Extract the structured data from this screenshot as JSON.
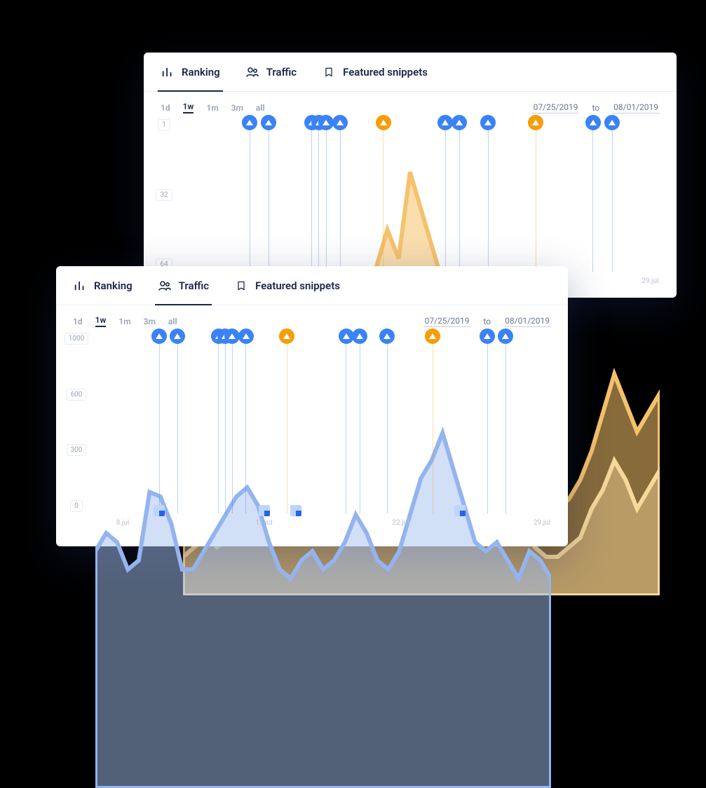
{
  "tabs": {
    "ranking": "Ranking",
    "traffic": "Traffic",
    "featured": "Featured snippets"
  },
  "ranges": {
    "d": "1d",
    "w": "1w",
    "m": "1m",
    "m3": "3m",
    "all": "all"
  },
  "dates": {
    "from": "07/25/2019",
    "sep": "to",
    "to": "08/01/2019"
  },
  "chart_data": [
    {
      "title": "Ranking",
      "type": "area",
      "y_inverted": true,
      "ylabels": [
        "1",
        "32",
        "64"
      ],
      "xlabels": [
        "8.jul",
        "15.jul",
        "22.jul",
        "29.jul"
      ],
      "x_positions_pct": [
        6,
        37,
        67,
        98
      ],
      "series": [
        {
          "name": "rank_a",
          "color": "#f5c26b",
          "fill": "rgba(245,194,107,0.55)",
          "points": [
            68,
            78,
            80,
            80,
            80,
            72,
            64,
            68,
            74,
            68,
            62,
            70,
            58,
            48,
            44,
            52,
            40,
            32,
            24,
            30,
            12,
            20,
            28,
            36,
            40,
            36,
            48,
            54,
            50,
            56,
            66,
            74,
            80,
            82,
            80,
            76,
            70,
            62,
            54,
            60,
            66,
            62,
            58
          ]
        },
        {
          "name": "rank_b",
          "color": "#f7d89a",
          "fill": "rgba(247,216,154,0.45)",
          "points": [
            92,
            90,
            88,
            90,
            88,
            84,
            86,
            88,
            86,
            84,
            80,
            76,
            78,
            72,
            66,
            70,
            62,
            58,
            50,
            54,
            46,
            52,
            56,
            62,
            66,
            64,
            70,
            76,
            74,
            80,
            86,
            90,
            92,
            92,
            90,
            88,
            82,
            78,
            72,
            76,
            82,
            78,
            74
          ]
        }
      ],
      "markers": [
        {
          "pos_pct": 14,
          "color": "blue"
        },
        {
          "pos_pct": 18,
          "color": "blue"
        },
        {
          "pos_pct": 27,
          "color": "blue"
        },
        {
          "pos_pct": 28.5,
          "color": "blue"
        },
        {
          "pos_pct": 30,
          "color": "blue"
        },
        {
          "pos_pct": 33,
          "color": "blue"
        },
        {
          "pos_pct": 42,
          "color": "orange"
        },
        {
          "pos_pct": 55,
          "color": "blue"
        },
        {
          "pos_pct": 58,
          "color": "blue"
        },
        {
          "pos_pct": 64,
          "color": "blue"
        },
        {
          "pos_pct": 74,
          "color": "orange"
        },
        {
          "pos_pct": 86,
          "color": "blue"
        },
        {
          "pos_pct": 90,
          "color": "blue"
        }
      ],
      "notes": []
    },
    {
      "title": "Traffic",
      "type": "area",
      "y_inverted": false,
      "ylabels": [
        "1000",
        "600",
        "300",
        "0"
      ],
      "xlabels": [
        "8.jul",
        "15.jul",
        "22.jul",
        "29.jul"
      ],
      "x_positions_pct": [
        6,
        37,
        67,
        98
      ],
      "series": [
        {
          "name": "traffic",
          "color": "#93b4ef",
          "fill": "rgba(164,192,239,0.5)",
          "points": [
            520,
            560,
            540,
            480,
            500,
            650,
            640,
            580,
            480,
            480,
            520,
            560,
            600,
            640,
            660,
            620,
            540,
            480,
            460,
            500,
            520,
            480,
            500,
            540,
            600,
            560,
            500,
            480,
            520,
            600,
            680,
            720,
            780,
            700,
            620,
            540,
            520,
            540,
            500,
            460,
            520,
            500,
            460
          ]
        }
      ],
      "markers": [
        {
          "pos_pct": 14,
          "color": "blue"
        },
        {
          "pos_pct": 18,
          "color": "blue"
        },
        {
          "pos_pct": 27,
          "color": "blue"
        },
        {
          "pos_pct": 28.5,
          "color": "blue"
        },
        {
          "pos_pct": 30,
          "color": "blue"
        },
        {
          "pos_pct": 33,
          "color": "blue"
        },
        {
          "pos_pct": 42,
          "color": "orange"
        },
        {
          "pos_pct": 55,
          "color": "blue"
        },
        {
          "pos_pct": 58,
          "color": "blue"
        },
        {
          "pos_pct": 64,
          "color": "blue"
        },
        {
          "pos_pct": 74,
          "color": "orange"
        },
        {
          "pos_pct": 86,
          "color": "blue"
        },
        {
          "pos_pct": 90,
          "color": "blue"
        }
      ],
      "notes": [
        {
          "pos_pct": 14
        },
        {
          "pos_pct": 37
        },
        {
          "pos_pct": 44
        },
        {
          "pos_pct": 80
        }
      ]
    }
  ]
}
